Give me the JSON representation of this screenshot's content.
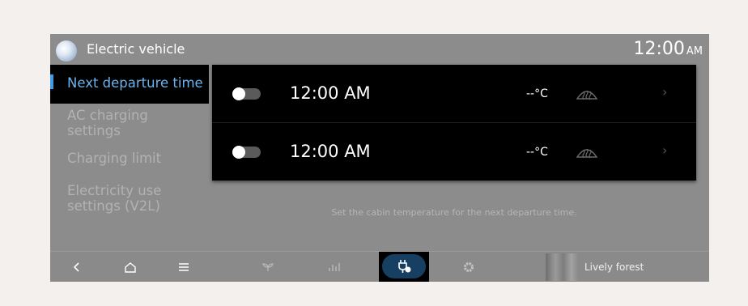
{
  "header": {
    "app_icon": "vehicle-app-icon",
    "title": "Electric vehicle",
    "time": "12:00",
    "ampm": "AM"
  },
  "sidebar": {
    "items": [
      {
        "label": "Next departure time",
        "active": true
      },
      {
        "label": "AC charging\nsettings",
        "active": false
      },
      {
        "label": "Charging limit",
        "active": false
      },
      {
        "label": "Electricity use\nsettings (V2L)",
        "active": false
      }
    ]
  },
  "departures": [
    {
      "enabled": false,
      "time": "12:00 AM",
      "temperature": "--°C",
      "defrost_icon": "front-defrost-icon"
    },
    {
      "enabled": false,
      "time": "12:00 AM",
      "temperature": "--°C",
      "defrost_icon": "front-defrost-icon"
    }
  ],
  "hint": "Set the cabin temperature for the next departure time.",
  "bottom_bar": {
    "items": [
      "back-icon",
      "home-icon",
      "menu-icon",
      "eco-leaf-icon",
      "energy-chart-icon",
      "ev-charging-icon",
      "settings-gear-icon"
    ],
    "media_label": "Lively forest"
  },
  "colors": {
    "accent": "#6bb2ee",
    "active_bar": "#3f99e3",
    "charging_button": "#173f61"
  }
}
